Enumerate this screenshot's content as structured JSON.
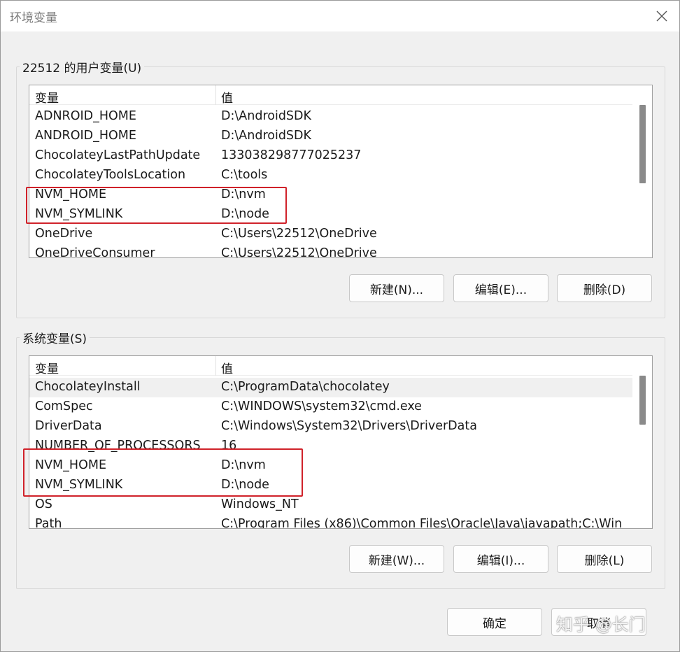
{
  "window": {
    "title": "环境变量",
    "close_icon": "close-icon"
  },
  "user_vars": {
    "legend": "22512 的用户变量(U)",
    "header": {
      "name": "变量",
      "value": "值"
    },
    "rows": [
      {
        "name": "ADNROID_HOME",
        "value": "D:\\AndroidSDK"
      },
      {
        "name": "ANDROID_HOME",
        "value": "D:\\AndroidSDK"
      },
      {
        "name": "ChocolateyLastPathUpdate",
        "value": "133038298777025237"
      },
      {
        "name": "ChocolateyToolsLocation",
        "value": "C:\\tools"
      },
      {
        "name": "NVM_HOME",
        "value": "D:\\nvm"
      },
      {
        "name": "NVM_SYMLINK",
        "value": "D:\\node"
      },
      {
        "name": "OneDrive",
        "value": "C:\\Users\\22512\\OneDrive"
      },
      {
        "name": "OneDriveConsumer",
        "value": "C:\\Users\\22512\\OneDrive"
      }
    ],
    "buttons": {
      "new": "新建(N)...",
      "edit": "编辑(E)...",
      "delete": "删除(D)"
    }
  },
  "system_vars": {
    "legend": "系统变量(S)",
    "header": {
      "name": "变量",
      "value": "值"
    },
    "rows": [
      {
        "name": "ChocolateyInstall",
        "value": "C:\\ProgramData\\chocolatey"
      },
      {
        "name": "ComSpec",
        "value": "C:\\WINDOWS\\system32\\cmd.exe"
      },
      {
        "name": "DriverData",
        "value": "C:\\Windows\\System32\\Drivers\\DriverData"
      },
      {
        "name": "NUMBER_OF_PROCESSORS",
        "value": "16"
      },
      {
        "name": "NVM_HOME",
        "value": "D:\\nvm"
      },
      {
        "name": "NVM_SYMLINK",
        "value": "D:\\node"
      },
      {
        "name": "OS",
        "value": "Windows_NT"
      },
      {
        "name": "Path",
        "value": "C:\\Program Files (x86)\\Common Files\\Oracle\\Java\\javapath;C:\\Win"
      }
    ],
    "buttons": {
      "new": "新建(W)...",
      "edit": "编辑(I)...",
      "delete": "删除(L)"
    }
  },
  "dialog_buttons": {
    "ok": "确定",
    "cancel": "取消"
  },
  "watermark": "知乎 @长门",
  "colors": {
    "highlight": "#d0222a",
    "selected_row": "#f0f0f0",
    "scrollbar_thumb": "#8a8a8a"
  }
}
